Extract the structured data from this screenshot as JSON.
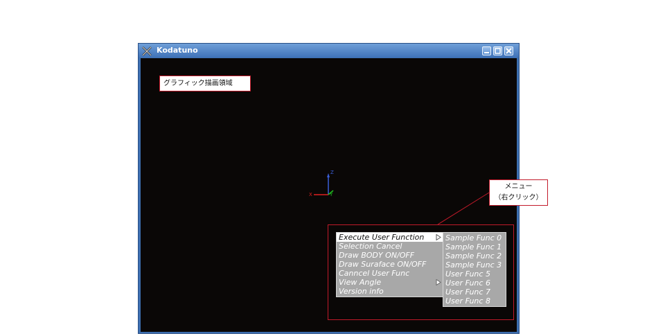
{
  "window": {
    "title": "Kodatuno",
    "accent_color": "#3e6fb0",
    "canvas_color": "#0a0706"
  },
  "annotations": {
    "graphics_area_label": "グラフィック描画領域",
    "menu_label_line1": "メニュー",
    "menu_label_line2": "（右クリック）",
    "callout_border_color": "#c21a2a"
  },
  "axes": {
    "z_label": "Z",
    "x_label": "X",
    "y_label": "Y"
  },
  "context_menu": {
    "items": [
      {
        "label": "Execute User Function",
        "submenu": true,
        "active": true
      },
      {
        "label": "Selection Cancel",
        "submenu": false
      },
      {
        "label": "Draw BODY ON/OFF",
        "submenu": false
      },
      {
        "label": "Draw Suraface ON/OFF",
        "submenu": false
      },
      {
        "label": "Canncel User Func",
        "submenu": false
      },
      {
        "label": "View Angle",
        "submenu": true
      },
      {
        "label": "Version info",
        "submenu": false
      }
    ]
  },
  "submenu": {
    "items": [
      {
        "label": "Sample Func 0"
      },
      {
        "label": "Sample Func 1"
      },
      {
        "label": "Sample Func 2"
      },
      {
        "label": "Sample Func 3"
      },
      {
        "label": "User Func 5"
      },
      {
        "label": "User Func 6"
      },
      {
        "label": "User Func 7"
      },
      {
        "label": "User Func 8"
      }
    ]
  }
}
